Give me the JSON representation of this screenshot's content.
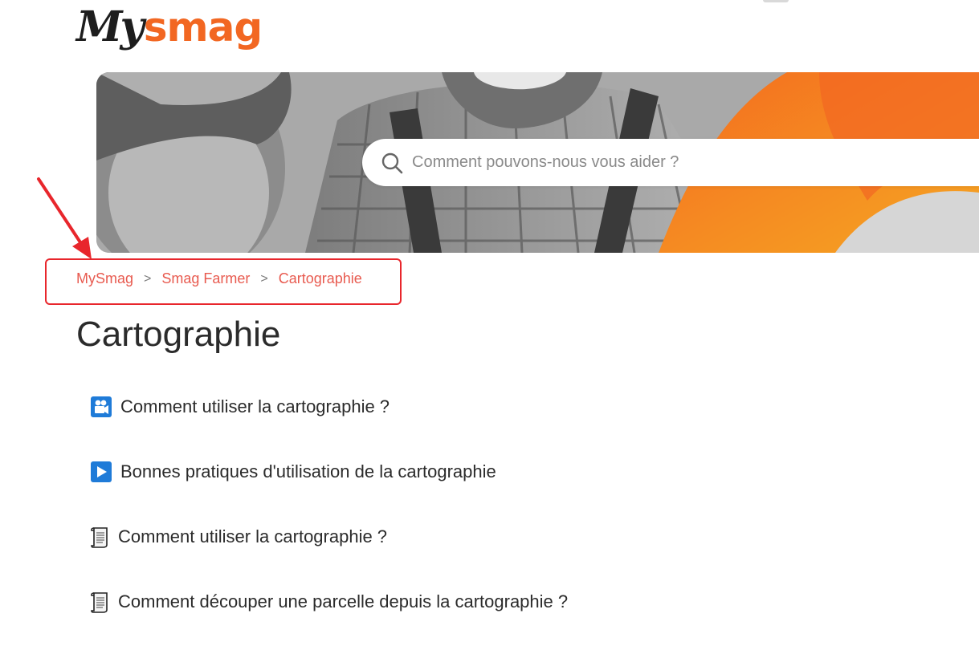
{
  "logo": {
    "part1": "My",
    "part2": "smag"
  },
  "colors": {
    "brand_orange": "#f26722",
    "breadcrumb": "#e85a4f",
    "annotation_red": "#e8262c",
    "video_blue": "#1f7bd8"
  },
  "search": {
    "placeholder": "Comment pouvons-nous vous aider ?",
    "icon": "search-icon"
  },
  "breadcrumb": {
    "items": [
      "MySmag",
      "Smag Farmer",
      "Cartographie"
    ],
    "separator": ">"
  },
  "page": {
    "title": "Cartographie"
  },
  "articles": [
    {
      "label": "Comment utiliser la cartographie ?",
      "icon": "video-camera-icon"
    },
    {
      "label": "Bonnes pratiques d'utilisation de la cartographie",
      "icon": "play-button-icon"
    },
    {
      "label": "Comment utiliser la cartographie ?",
      "icon": "scroll-icon"
    },
    {
      "label": "Comment découper une parcelle depuis la cartographie ?",
      "icon": "scroll-icon"
    }
  ]
}
